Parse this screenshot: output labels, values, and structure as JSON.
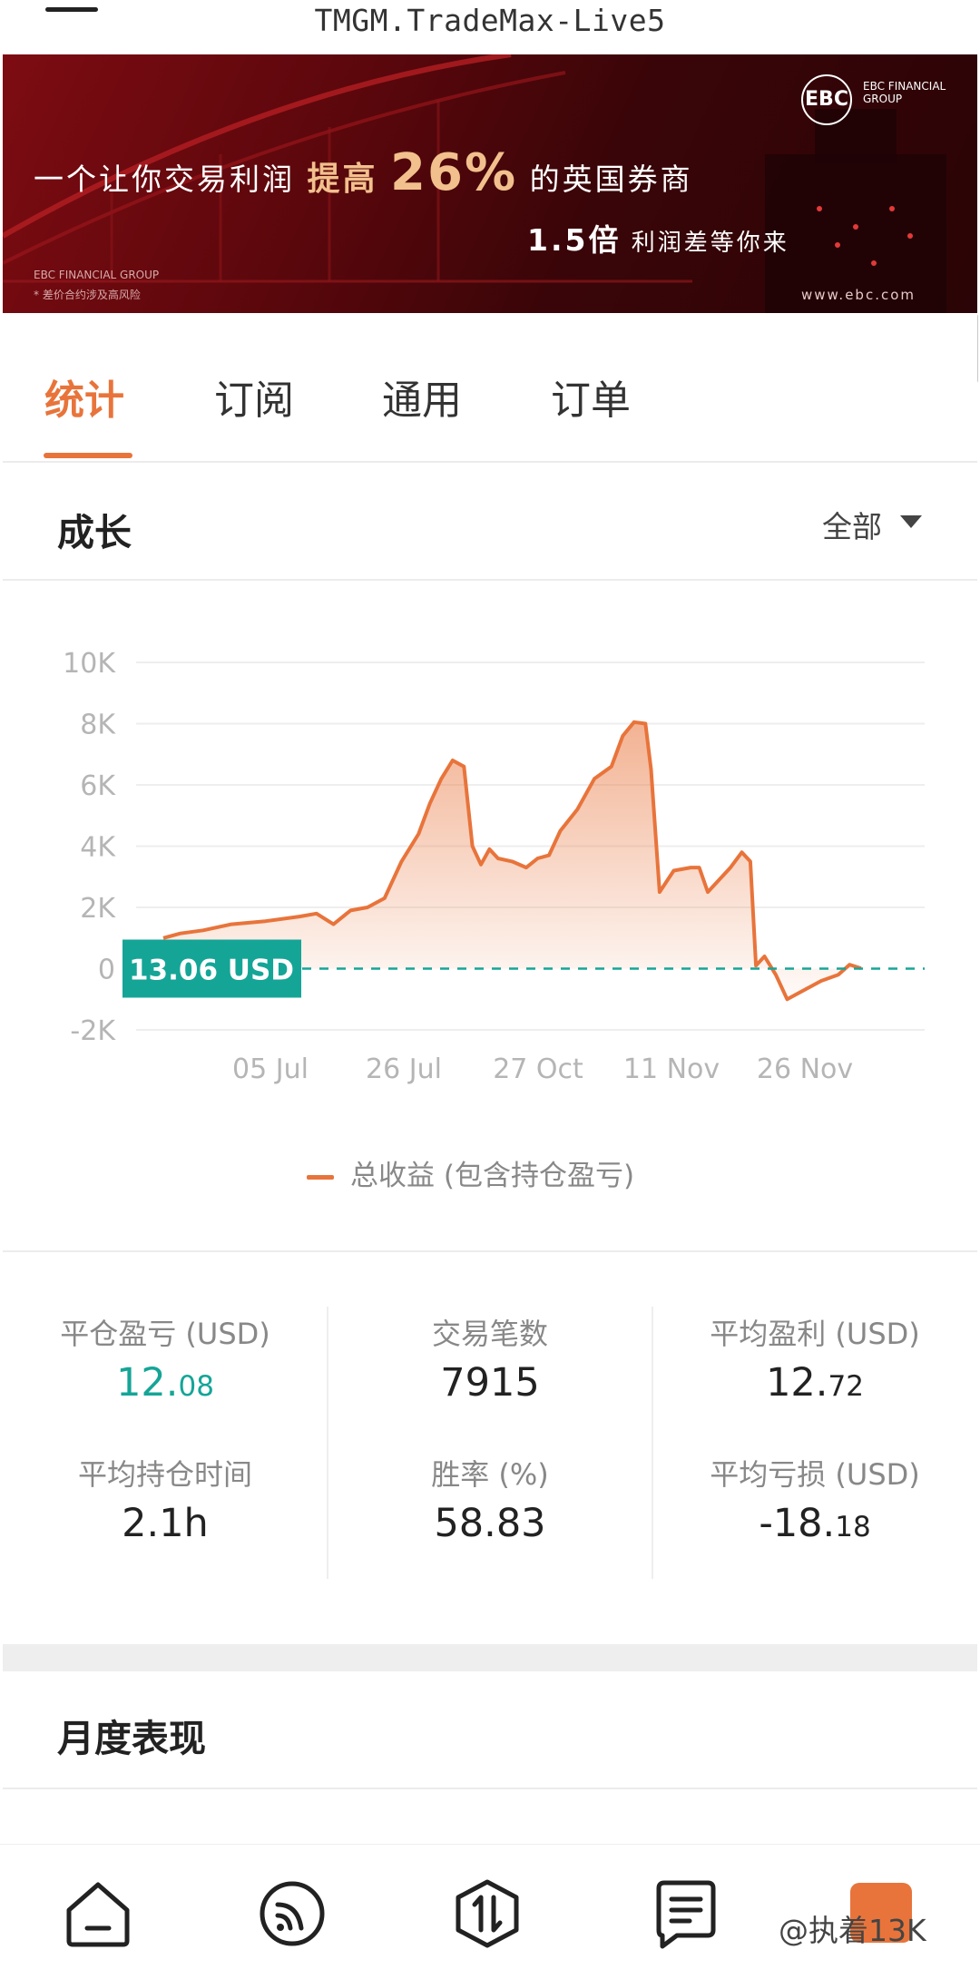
{
  "app": {
    "title": "TMGM.TradeMax-Live5"
  },
  "banner": {
    "headline_pre": "一个让你交易利润",
    "headline_hl": "提高",
    "headline_big": "26%",
    "headline_post": "的英国券商",
    "sub_big": "1.5倍",
    "sub_text": "利润差等你来",
    "logo_mark": "EBC",
    "logo_text": "EBC FINANCIAL GROUP",
    "foot_brand": "EBC FINANCIAL GROUP",
    "foot_risk": "* 差价合约涉及高风险",
    "url": "www.ebc.com"
  },
  "tabs": [
    {
      "label": "统计",
      "active": true
    },
    {
      "label": "订阅",
      "active": false
    },
    {
      "label": "通用",
      "active": false
    },
    {
      "label": "订单",
      "active": false
    }
  ],
  "growth": {
    "title": "成长",
    "filter": "全部"
  },
  "chart_data": {
    "type": "area",
    "y_ticks": [
      "10K",
      "8K",
      "6K",
      "4K",
      "2K",
      "0",
      "-2K"
    ],
    "ylim": [
      -2000,
      10000
    ],
    "x_ticks": [
      "05 Jul",
      "26 Jul",
      "27 Oct",
      "11 Nov",
      "26 Nov"
    ],
    "current_label": "13.06 USD",
    "series": [
      {
        "name": "总收益 (包含持仓盈亏)",
        "color": "#e8743b",
        "points": [
          [
            0.0,
            1000
          ],
          [
            0.03,
            1150
          ],
          [
            0.07,
            1250
          ],
          [
            0.12,
            1450
          ],
          [
            0.18,
            1550
          ],
          [
            0.24,
            1700
          ],
          [
            0.27,
            1800
          ],
          [
            0.3,
            1450
          ],
          [
            0.33,
            1900
          ],
          [
            0.36,
            2000
          ],
          [
            0.39,
            2300
          ],
          [
            0.42,
            3500
          ],
          [
            0.45,
            4400
          ],
          [
            0.47,
            5400
          ],
          [
            0.49,
            6200
          ],
          [
            0.51,
            6800
          ],
          [
            0.53,
            6600
          ],
          [
            0.545,
            4000
          ],
          [
            0.56,
            3400
          ],
          [
            0.575,
            3900
          ],
          [
            0.59,
            3600
          ],
          [
            0.615,
            3500
          ],
          [
            0.64,
            3300
          ],
          [
            0.66,
            3600
          ],
          [
            0.68,
            3700
          ],
          [
            0.7,
            4500
          ],
          [
            0.73,
            5200
          ],
          [
            0.76,
            6200
          ],
          [
            0.79,
            6600
          ],
          [
            0.81,
            7600
          ],
          [
            0.83,
            8050
          ],
          [
            0.85,
            8000
          ],
          [
            0.86,
            6500
          ],
          [
            0.875,
            2500
          ],
          [
            0.9,
            3200
          ],
          [
            0.93,
            3300
          ],
          [
            0.945,
            3300
          ],
          [
            0.96,
            2500
          ],
          [
            0.98,
            2900
          ],
          [
            1.0,
            3300
          ],
          [
            1.02,
            3800
          ],
          [
            1.035,
            3500
          ],
          [
            1.045,
            100
          ],
          [
            1.06,
            400
          ],
          [
            1.08,
            -200
          ],
          [
            1.1,
            -1000
          ],
          [
            1.13,
            -700
          ],
          [
            1.16,
            -400
          ],
          [
            1.19,
            -200
          ],
          [
            1.21,
            130
          ],
          [
            1.23,
            13
          ]
        ]
      }
    ]
  },
  "stats": [
    {
      "label": "平仓盈亏 (USD)",
      "int": "12.",
      "dec": "08",
      "green": true
    },
    {
      "label": "交易笔数",
      "int": "7915",
      "dec": "",
      "green": false
    },
    {
      "label": "平均盈利 (USD)",
      "int": "12.",
      "dec": "72",
      "green": false
    },
    {
      "label": "平均持仓时间",
      "int": "2.1h",
      "dec": "",
      "green": false
    },
    {
      "label": "胜率 (%)",
      "int": "58.83",
      "dec": "",
      "green": false
    },
    {
      "label": "平均亏损 (USD)",
      "int": "-18.",
      "dec": "18",
      "green": false
    }
  ],
  "monthly": {
    "title": "月度表现"
  },
  "bottom_nav": [
    {
      "icon": "home-icon"
    },
    {
      "icon": "feed-icon"
    },
    {
      "icon": "trade-icon"
    },
    {
      "icon": "notes-icon"
    },
    {
      "icon": "profile-icon",
      "active": true
    }
  ],
  "watermark": "@执着13K",
  "colors": {
    "accent": "#e8743b",
    "green": "#15a597"
  }
}
